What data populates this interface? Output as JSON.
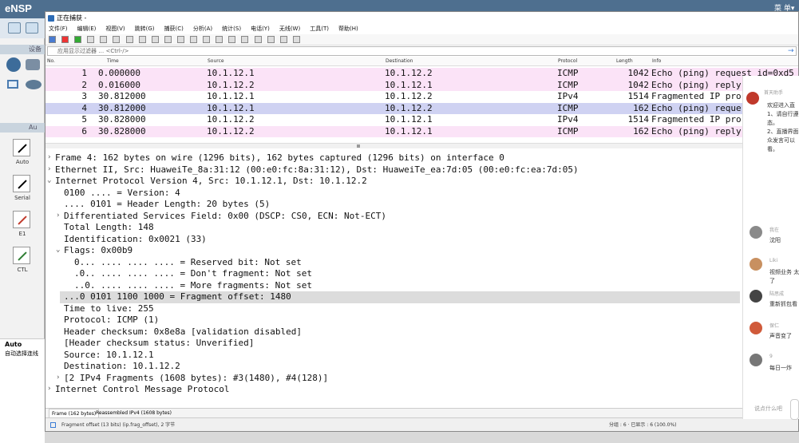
{
  "ensp": {
    "logo": "eNSP",
    "right_text": "菜 单▾",
    "left_panel": {
      "section1": "设备",
      "section2": "Au",
      "links": [
        {
          "label": "Auto",
          "icon": "lightning-icon",
          "color": "#000000"
        },
        {
          "label": "Serial",
          "icon": "serial-cable-icon",
          "color": "#000000"
        },
        {
          "label": "E1",
          "icon": "e1-cable-icon",
          "color": "#c0392b"
        },
        {
          "label": "CTL",
          "icon": "ctl-cable-icon",
          "color": "#2e7d32"
        }
      ],
      "bottom_title": "Auto",
      "bottom_desc": "自动选择连线"
    }
  },
  "window": {
    "title": "正在捕获 -",
    "menu": [
      "文件(F)",
      "编辑(E)",
      "视图(V)",
      "跳转(G)",
      "捕获(C)",
      "分析(A)",
      "统计(S)",
      "电话(Y)",
      "无线(W)",
      "工具(T)",
      "帮助(H)"
    ],
    "filter_placeholder": "应用显示过滤器 … <Ctrl-/>"
  },
  "packet_list": {
    "columns": [
      "No.",
      "Time",
      "Source",
      "Destination",
      "Protocol",
      "Length",
      "Info"
    ],
    "rows": [
      {
        "no": "1",
        "time": "0.000000",
        "src": "10.1.12.1",
        "dst": "10.1.12.2",
        "proto": "ICMP",
        "len": "1042",
        "info": "Echo (ping) request  id=0xd5",
        "bg": "#fbe3f7"
      },
      {
        "no": "2",
        "time": "0.016000",
        "src": "10.1.12.2",
        "dst": "10.1.12.1",
        "proto": "ICMP",
        "len": "1042",
        "info": "Echo (ping) reply",
        "bg": "#fbe3f7"
      },
      {
        "no": "3",
        "time": "30.812000",
        "src": "10.1.12.1",
        "dst": "10.1.12.2",
        "proto": "IPv4",
        "len": "1514",
        "info": "Fragmented IP pro",
        "bg": "#ffffff"
      },
      {
        "no": "4",
        "time": "30.812000",
        "src": "10.1.12.1",
        "dst": "10.1.12.2",
        "proto": "ICMP",
        "len": "162",
        "info": "Echo (ping) reque",
        "bg": "#cfd2f2"
      },
      {
        "no": "5",
        "time": "30.828000",
        "src": "10.1.12.2",
        "dst": "10.1.12.1",
        "proto": "IPv4",
        "len": "1514",
        "info": "Fragmented IP pro",
        "bg": "#ffffff"
      },
      {
        "no": "6",
        "time": "30.828000",
        "src": "10.1.12.2",
        "dst": "10.1.12.1",
        "proto": "ICMP",
        "len": "162",
        "info": "Echo (ping) reply",
        "bg": "#fbe3f7"
      }
    ]
  },
  "details": [
    {
      "indent": 0,
      "arrow": "›",
      "text": "Frame 4: 162 bytes on wire (1296 bits), 162 bytes captured (1296 bits) on interface 0"
    },
    {
      "indent": 0,
      "arrow": "›",
      "text": "Ethernet II, Src: HuaweiTe_8a:31:12 (00:e0:fc:8a:31:12), Dst: HuaweiTe_ea:7d:05 (00:e0:fc:ea:7d:05)"
    },
    {
      "indent": 0,
      "arrow": "⌄",
      "text": "Internet Protocol Version 4, Src: 10.1.12.1, Dst: 10.1.12.2"
    },
    {
      "indent": 1,
      "arrow": "",
      "text": "0100 .... = Version: 4"
    },
    {
      "indent": 1,
      "arrow": "",
      "text": ".... 0101 = Header Length: 20 bytes (5)"
    },
    {
      "indent": 1,
      "arrow": "›",
      "text": "Differentiated Services Field: 0x00 (DSCP: CS0, ECN: Not-ECT)"
    },
    {
      "indent": 1,
      "arrow": "",
      "text": "Total Length: 148"
    },
    {
      "indent": 1,
      "arrow": "",
      "text": "Identification: 0x0021 (33)"
    },
    {
      "indent": 1,
      "arrow": "⌄",
      "text": "Flags: 0x00b9"
    },
    {
      "indent": 2,
      "arrow": "",
      "text": "0... .... .... .... = Reserved bit: Not set"
    },
    {
      "indent": 2,
      "arrow": "",
      "text": ".0.. .... .... .... = Don't fragment: Not set"
    },
    {
      "indent": 2,
      "arrow": "",
      "text": "..0. .... .... .... = More fragments: Not set"
    },
    {
      "indent": 1,
      "arrow": "",
      "text": "...0 0101 1100 1000 = Fragment offset: 1480",
      "highlight": true
    },
    {
      "indent": 1,
      "arrow": "",
      "text": "Time to live: 255"
    },
    {
      "indent": 1,
      "arrow": "",
      "text": "Protocol: ICMP (1)"
    },
    {
      "indent": 1,
      "arrow": "",
      "text": "Header checksum: 0x8e8a [validation disabled]"
    },
    {
      "indent": 1,
      "arrow": "",
      "text": "[Header checksum status: Unverified]"
    },
    {
      "indent": 1,
      "arrow": "",
      "text": "Source: 10.1.12.1"
    },
    {
      "indent": 1,
      "arrow": "",
      "text": "Destination: 10.1.12.2"
    },
    {
      "indent": 1,
      "arrow": "›",
      "text": "[2 IPv4 Fragments (1608 bytes): #3(1480), #4(128)]"
    },
    {
      "indent": 0,
      "arrow": "›",
      "text": "Internet Control Message Protocol"
    }
  ],
  "bottom_tabs": [
    "Frame (162 bytes)",
    "Reassembled IPv4 (1608 bytes)"
  ],
  "status": {
    "left": "Fragment offset (13 bits) (ip.frag_offset), 2 字节",
    "right": "分组 : 6 · 已显示 : 6 (100.0%)"
  },
  "chat": {
    "header": "首天助手",
    "intro": [
      "欢迎进入直",
      "1、请自行遵",
      "态。",
      "2、直播界面",
      "众发言可以",
      "看。"
    ],
    "messages": [
      {
        "user": "我在",
        "text": "沈阳",
        "avatar": "#8a8a8a"
      },
      {
        "user": "Liki",
        "text": "视频业务 太",
        "text2": "了",
        "avatar": "#c89060"
      },
      {
        "user": "陆思成",
        "text": "重新抓包看",
        "avatar": "#444444"
      },
      {
        "user": "保仁",
        "text": "声音变了",
        "avatar": "#d05a3a"
      },
      {
        "user": "9",
        "text": "每日一炸",
        "avatar": "#777777"
      }
    ],
    "input_placeholder": "说点什么吧"
  }
}
